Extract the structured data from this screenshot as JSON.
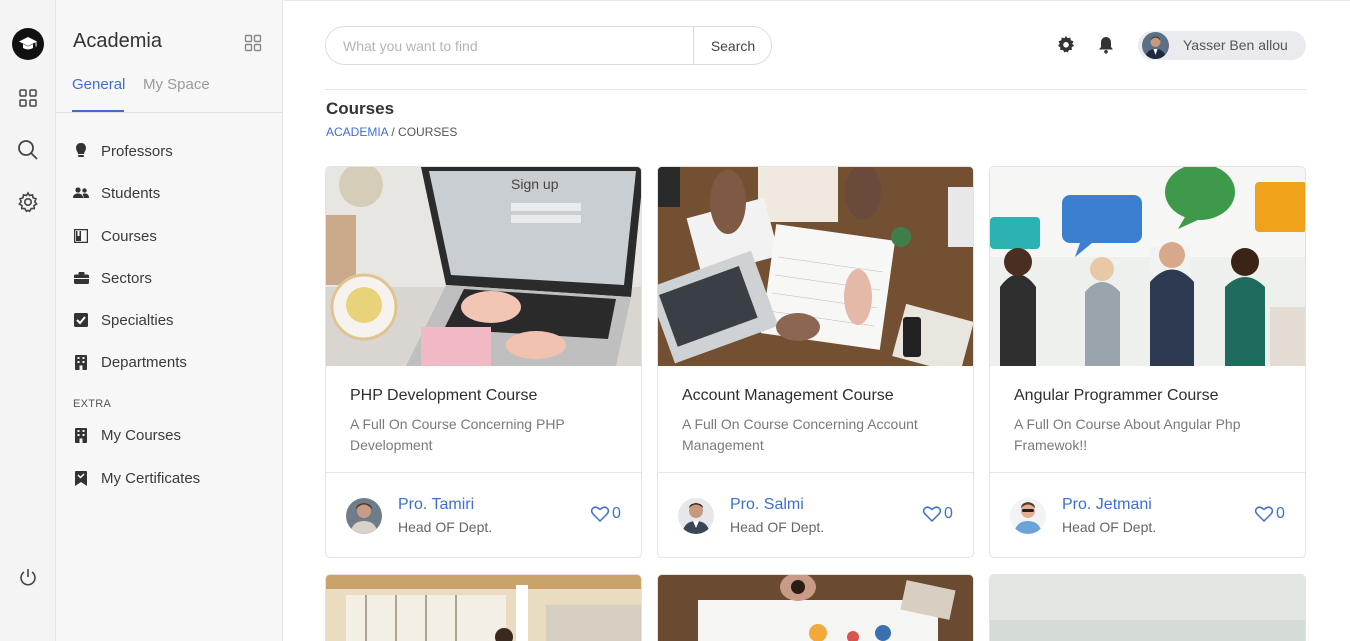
{
  "app": {
    "brand": "Academia"
  },
  "sidebar": {
    "tabs": [
      {
        "label": "General"
      },
      {
        "label": "My Space"
      }
    ],
    "items": [
      {
        "label": "Professors",
        "icon": "professor-icon"
      },
      {
        "label": "Students",
        "icon": "students-icon"
      },
      {
        "label": "Courses",
        "icon": "courses-icon"
      },
      {
        "label": "Sectors",
        "icon": "sectors-icon"
      },
      {
        "label": "Specialties",
        "icon": "specialties-icon"
      },
      {
        "label": "Departments",
        "icon": "departments-icon"
      }
    ],
    "extra_title": "EXTRA",
    "extra_items": [
      {
        "label": "My Courses",
        "icon": "my-courses-icon"
      },
      {
        "label": "My Certificates",
        "icon": "certificate-icon"
      }
    ]
  },
  "search": {
    "placeholder": "What you want to find",
    "value": "",
    "button_label": "Search"
  },
  "user": {
    "name": "Yasser Ben allou"
  },
  "page": {
    "title": "Courses",
    "breadcrumb": {
      "root": "ACADEMIA",
      "sep": " / ",
      "current": "COURSES"
    }
  },
  "courses": [
    {
      "title": "PHP Development Course",
      "description": "A Full On Course Concerning PHP Development",
      "professor": "Pro. Tamiri",
      "role": "Head OF Dept.",
      "likes": "0"
    },
    {
      "title": "Account Management Course",
      "description": "A Full On Course Concerning Account Management",
      "professor": "Pro. Salmi",
      "role": "Head OF Dept.",
      "likes": "0"
    },
    {
      "title": "Angular Programmer Course",
      "description": "A Full On Course About Angular Php Framewok!!",
      "professor": "Pro. Jetmani",
      "role": "Head OF Dept.",
      "likes": "0"
    }
  ],
  "colors": {
    "accent": "#3d6fd1",
    "sidebar_bg": "#f7f7f7",
    "rail_bg": "#f4f4f4"
  }
}
